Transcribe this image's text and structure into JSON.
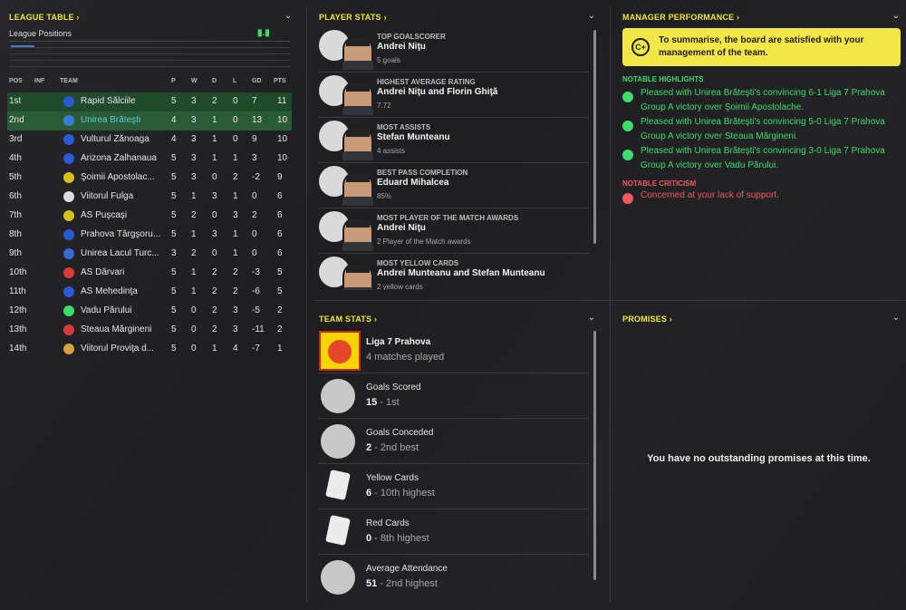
{
  "panels": {
    "league_table": "LEAGUE TABLE",
    "player_stats": "PLAYER STATS",
    "manager_performance": "MANAGER PERFORMANCE",
    "team_stats": "TEAM STATS",
    "promises": "PROMISES"
  },
  "league": {
    "positions_label": "League Positions",
    "headers": [
      "POS",
      "INF",
      "TEAM",
      "P",
      "W",
      "D",
      "L",
      "GD",
      "PTS"
    ],
    "rows": [
      {
        "pos": "1st",
        "team": "Rapid Sălciile",
        "p": "5",
        "w": "3",
        "d": "2",
        "l": "0",
        "gd": "7",
        "pts": "11"
      },
      {
        "pos": "2nd",
        "team": "Unirea Brăteşti",
        "p": "4",
        "w": "3",
        "d": "1",
        "l": "0",
        "gd": "13",
        "pts": "10"
      },
      {
        "pos": "3rd",
        "team": "Vulturul Zănoaga",
        "p": "4",
        "w": "3",
        "d": "1",
        "l": "0",
        "gd": "9",
        "pts": "10"
      },
      {
        "pos": "4th",
        "team": "Arizona Zalhanaua",
        "p": "5",
        "w": "3",
        "d": "1",
        "l": "1",
        "gd": "3",
        "pts": "10"
      },
      {
        "pos": "5th",
        "team": "Şoimii Apostolac...",
        "p": "5",
        "w": "3",
        "d": "0",
        "l": "2",
        "gd": "-2",
        "pts": "9"
      },
      {
        "pos": "6th",
        "team": "Viitorul Fulga",
        "p": "5",
        "w": "1",
        "d": "3",
        "l": "1",
        "gd": "0",
        "pts": "6"
      },
      {
        "pos": "7th",
        "team": "AS Puşcaşi",
        "p": "5",
        "w": "2",
        "d": "0",
        "l": "3",
        "gd": "2",
        "pts": "6"
      },
      {
        "pos": "8th",
        "team": "Prahova Târgşoru...",
        "p": "5",
        "w": "1",
        "d": "3",
        "l": "1",
        "gd": "0",
        "pts": "6"
      },
      {
        "pos": "9th",
        "team": "Unirea Lacul Turc...",
        "p": "3",
        "w": "2",
        "d": "0",
        "l": "1",
        "gd": "0",
        "pts": "6"
      },
      {
        "pos": "10th",
        "team": "AS Dârvari",
        "p": "5",
        "w": "1",
        "d": "2",
        "l": "2",
        "gd": "-3",
        "pts": "5"
      },
      {
        "pos": "11th",
        "team": "AS Mehedinţa",
        "p": "5",
        "w": "1",
        "d": "2",
        "l": "2",
        "gd": "-6",
        "pts": "5"
      },
      {
        "pos": "12th",
        "team": "Vadu Părului",
        "p": "5",
        "w": "0",
        "d": "2",
        "l": "3",
        "gd": "-5",
        "pts": "2"
      },
      {
        "pos": "13th",
        "team": "Steaua Mărgineni",
        "p": "5",
        "w": "0",
        "d": "2",
        "l": "3",
        "gd": "-11",
        "pts": "2"
      },
      {
        "pos": "14th",
        "team": "Viitorul Proviţa d...",
        "p": "5",
        "w": "0",
        "d": "1",
        "l": "4",
        "gd": "-7",
        "pts": "1"
      }
    ]
  },
  "player_stats": [
    {
      "category": "TOP GOALSCORER",
      "name": "Andrei Niţu",
      "sub": "5 goals",
      "icon": "football-icon"
    },
    {
      "category": "HIGHEST AVERAGE RATING",
      "name": "Andrei Niţu and Florin Ghiţă",
      "sub": "7.72",
      "icon": "rating-gear-icon"
    },
    {
      "category": "MOST ASSISTS",
      "name": "Stefan Munteanu",
      "sub": "4 assists",
      "icon": "assist-icon"
    },
    {
      "category": "BEST PASS COMPLETION",
      "name": "Eduard Mihalcea",
      "sub": "85%",
      "icon": "percent-icon"
    },
    {
      "category": "MOST PLAYER OF THE MATCH AWARDS",
      "name": "Andrei Niţu",
      "sub": "2 Player of the Match awards",
      "icon": "star-icon"
    },
    {
      "category": "MOST YELLOW CARDS",
      "name": "Andrei Munteanu and Stefan Munteanu",
      "sub": "2 yellow cards",
      "icon": "card-icon"
    }
  ],
  "manager": {
    "grade": "C+",
    "summary": "To summarise, the board are satisfied with your management of the team.",
    "highlights_title": "NOTABLE HIGHLIGHTS",
    "highlights": [
      "Pleased with Unirea Brăteşti's convincing 6-1 Liga 7 Prahova Group A victory over Şoimii Apostolache.",
      "Pleased with Unirea Brăteşti's convincing 5-0 Liga 7 Prahova Group A victory over Steaua Mărgineni.",
      "Pleased with Unirea Brăteşti's convincing 3-0 Liga 7 Prahova Group A victory over Vadu Părului."
    ],
    "criticism_title": "NOTABLE CRITICISM",
    "criticism": "Concerned at your lack of support."
  },
  "team_stats": {
    "competition": "Liga 7 Prahova",
    "matches": "4 matches played",
    "items": [
      {
        "label": "Goals Scored",
        "value": "15",
        "rank": " - 1st",
        "icon": "ball-check-icon"
      },
      {
        "label": "Goals Conceded",
        "value": "2",
        "rank": " - 2nd best",
        "icon": "ball-cross-icon"
      },
      {
        "label": "Yellow Cards",
        "value": "6",
        "rank": " - 10th highest",
        "icon": "yellow-card-icon"
      },
      {
        "label": "Red Cards",
        "value": "0",
        "rank": " - 8th highest",
        "icon": "red-card-icon"
      },
      {
        "label": "Average Attendance",
        "value": "51",
        "rank": " - 2nd highest",
        "icon": "stadium-icon"
      }
    ]
  },
  "promises": {
    "message": "You have no outstanding promises at this time."
  },
  "colors": {
    "accent": "#f0e63c",
    "positive": "#3ddc6a",
    "negative": "#ef5a5a",
    "highlight_row": "#1f4a2c"
  }
}
